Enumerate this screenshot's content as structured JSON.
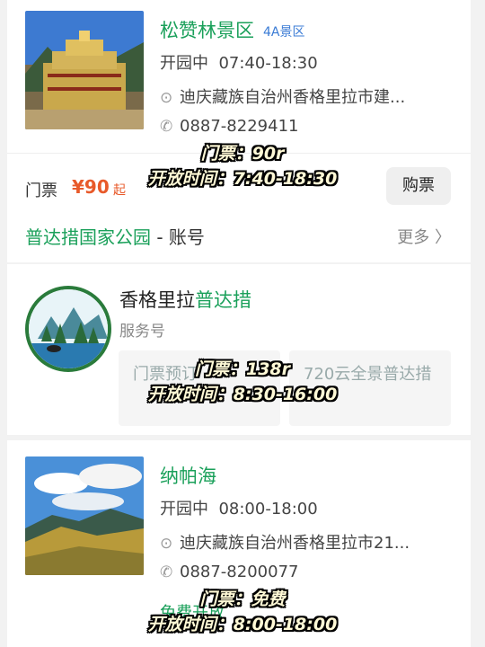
{
  "card1": {
    "name": "松赞林景区",
    "badge": "4A景区",
    "status": "开园中",
    "hours": "07:40-18:30",
    "address": "迪庆藏族自治州香格里拉市建...",
    "phone": "0887-8229411",
    "ticket_label": "门票",
    "ticket_price": "¥90",
    "ticket_suffix": "起",
    "buy_label": "购票"
  },
  "overlay1": {
    "line1": "门票：90r",
    "line2": "开放时间：7:40-18:30"
  },
  "account_header": {
    "title": "普达措国家公园",
    "sep": " - 账号",
    "more": "更多 〉"
  },
  "account": {
    "name_prefix": "香格里拉",
    "name_highlight": "普达措",
    "type": "服务号",
    "menu": [
      "门票预订",
      "720云全景普达措"
    ]
  },
  "overlay2": {
    "line1": "门票：138r",
    "line2": "开放时间：8:30-16:00"
  },
  "card3": {
    "name": "纳帕海",
    "status": "开园中",
    "hours": "08:00-18:00",
    "address": "迪庆藏族自治州香格里拉市21...",
    "phone": "0887-8200077",
    "free_label": "免费开放"
  },
  "overlay3": {
    "line1": "门票：免费",
    "line2": "开放时间：8:00-18:00"
  },
  "colors": {
    "accent": "#1aa05a",
    "price": "#e85a2a",
    "link": "#3a7bd5"
  }
}
